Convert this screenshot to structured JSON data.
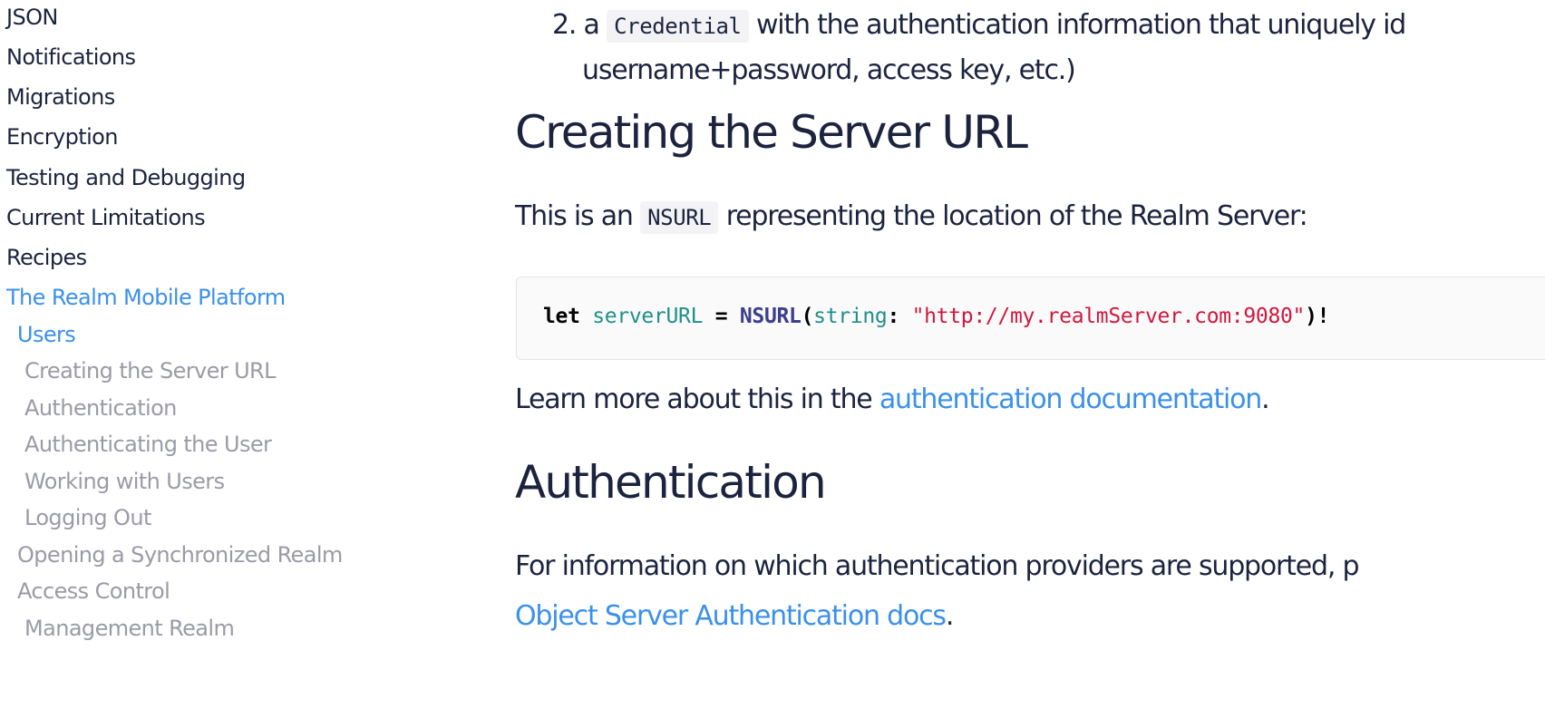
{
  "sidebar": {
    "items": [
      {
        "label": "JSON"
      },
      {
        "label": "Notifications"
      },
      {
        "label": "Migrations"
      },
      {
        "label": "Encryption"
      },
      {
        "label": "Testing and Debugging"
      },
      {
        "label": "Current Limitations"
      },
      {
        "label": "Recipes"
      },
      {
        "label": "The Realm Mobile Platform"
      },
      {
        "label": "Users"
      },
      {
        "label": "Creating the Server URL"
      },
      {
        "label": "Authentication"
      },
      {
        "label": "Authenticating the User"
      },
      {
        "label": "Working with Users"
      },
      {
        "label": "Logging Out"
      },
      {
        "label": "Opening a Synchronized Realm"
      },
      {
        "label": "Access Control"
      },
      {
        "label": "Management Realm"
      }
    ]
  },
  "content": {
    "list_item": {
      "number": "2. a",
      "code": "Credential",
      "text_line1": "with the authentication information that uniquely id",
      "text_line2": "username+password, access key, etc.)"
    },
    "section1": {
      "heading": "Creating the Server URL",
      "para_before": "This is an",
      "para_code": "NSURL",
      "para_after": "representing the location of the Realm Server:",
      "code": {
        "kw": "let",
        "var": "serverURL",
        "op": "=",
        "type": "NSURL",
        "open": "(",
        "param": "string",
        "colon": ":",
        "str": "\"http://my.realmServer.com:9080\"",
        "close": ")!"
      },
      "learn_before": "Learn more about this in the",
      "learn_link": "authentication documentation",
      "learn_after": "."
    },
    "section2": {
      "heading": "Authentication",
      "para_line1": "For information on which authentication providers are supported, p",
      "para_link": "Object Server Authentication docs",
      "para_after": "."
    }
  }
}
